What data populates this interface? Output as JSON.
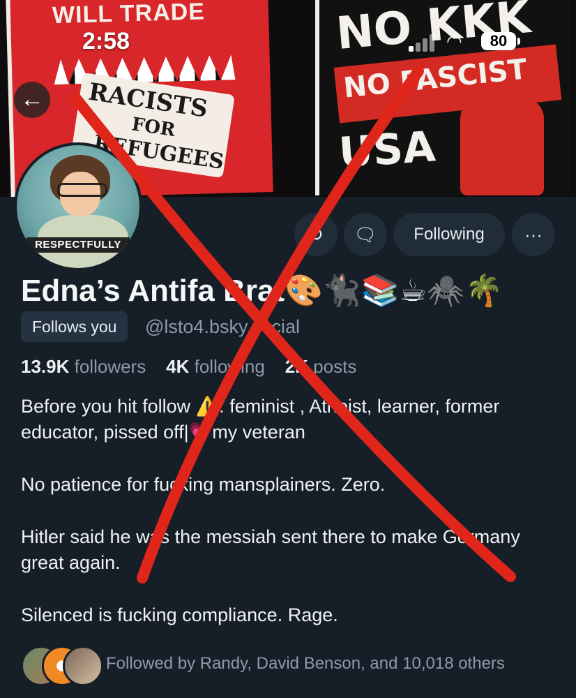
{
  "status_bar": {
    "time": "2:58",
    "battery": "80"
  },
  "banner": {
    "left_poster": {
      "top": "WILL TRADE",
      "line1": "RACISTS",
      "line2": "FOR",
      "line3": "REFUGEES"
    },
    "right_poster": {
      "line1": "NO KKK",
      "line2": "NO FASCIST",
      "line3": "USA"
    }
  },
  "avatar": {
    "label": "RESPECTFULLY"
  },
  "actions": {
    "following_label": "Following",
    "more_label": "···"
  },
  "profile": {
    "display_name": "Edna’s Antifa Brat🎨🐈‍⬛📚☕🕷️🌴",
    "follows_you": "Follows you",
    "handle": "@lsto4.bsky.social",
    "followers_count": "13.9K",
    "followers_label": "followers",
    "following_count": "4K",
    "following_label": "following",
    "posts_count": "2K",
    "posts_label": "posts",
    "bio": [
      "Before you hit follow ⚠️: feminist , Atheist, learner, former educator, pissed off|💗my veteran",
      "No patience for fucking mansplainers. Zero.",
      "Hitler said he was the messiah sent there to make Germany great again.",
      "Silenced is fucking compliance. Rage."
    ],
    "followed_by": "Followed by Randy, David Benson, and 10,018 others"
  },
  "colors": {
    "background": "#161e27",
    "button_bg": "#212c39",
    "muted": "#8c9aaa",
    "overlay_x": "#e0261a"
  }
}
